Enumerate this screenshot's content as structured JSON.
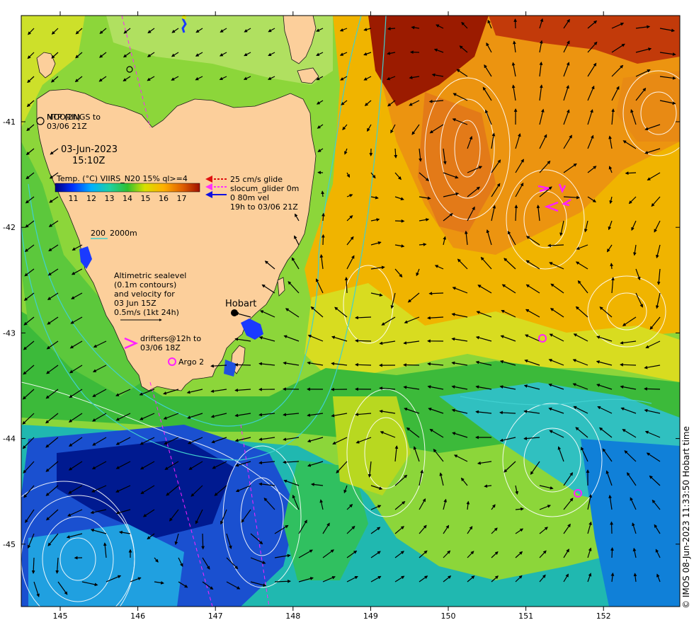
{
  "title": {
    "date": "03-Jun-2023",
    "time": "15:10Z"
  },
  "colorbar": {
    "label": "Temp. (°C) VIIRS_N20 15% ql>=4",
    "ticks": [
      "11",
      "12",
      "13",
      "14",
      "15",
      "16",
      "17"
    ],
    "range": [
      10,
      18
    ]
  },
  "glider_legend": {
    "line1": "25 cm/s glide",
    "line2": "slocum_glider 0m",
    "line3": "0 80m vel",
    "line4": "19h to 03/06 21Z",
    "colors": [
      "#e01010",
      "#ff30ff",
      "#1010e0"
    ]
  },
  "mooring_label": {
    "line1": "MOORINGS to",
    "line1b": "NTP (2h)",
    "line2": "03/06 21Z"
  },
  "isobath_legend": {
    "label_a": "200",
    "label_b": "2000m"
  },
  "altimetry_note": {
    "lines": [
      "Altimetric sealevel",
      "(0.1m contours)",
      "and velocity for",
      "03 Jun 15Z",
      "0.5m/s (1kt 24h)"
    ]
  },
  "drifter_legend": {
    "line1": "drifters@12h to",
    "line2": "03/06 18Z"
  },
  "argo_legend": {
    "label": "Argo 2"
  },
  "place_label": {
    "hobart": "Hobart"
  },
  "lat_axis": {
    "labels": [
      "-41",
      "-42",
      "-43",
      "-44",
      "-45"
    ],
    "values": [
      -41,
      -42,
      -43,
      -44,
      -45
    ]
  },
  "lon_axis": {
    "labels": [
      "145",
      "146",
      "147",
      "148",
      "149",
      "150",
      "151",
      "152"
    ],
    "values": [
      145,
      146,
      147,
      148,
      149,
      150,
      151,
      152
    ]
  },
  "credit": "© IMOS 08-Jun-2023 11:33:50 Hobart time",
  "colors": {
    "land": "#fccf9b",
    "accent_magenta": "#ff20ff",
    "contour": "#ffffff",
    "isobath": "#40d0d0"
  }
}
